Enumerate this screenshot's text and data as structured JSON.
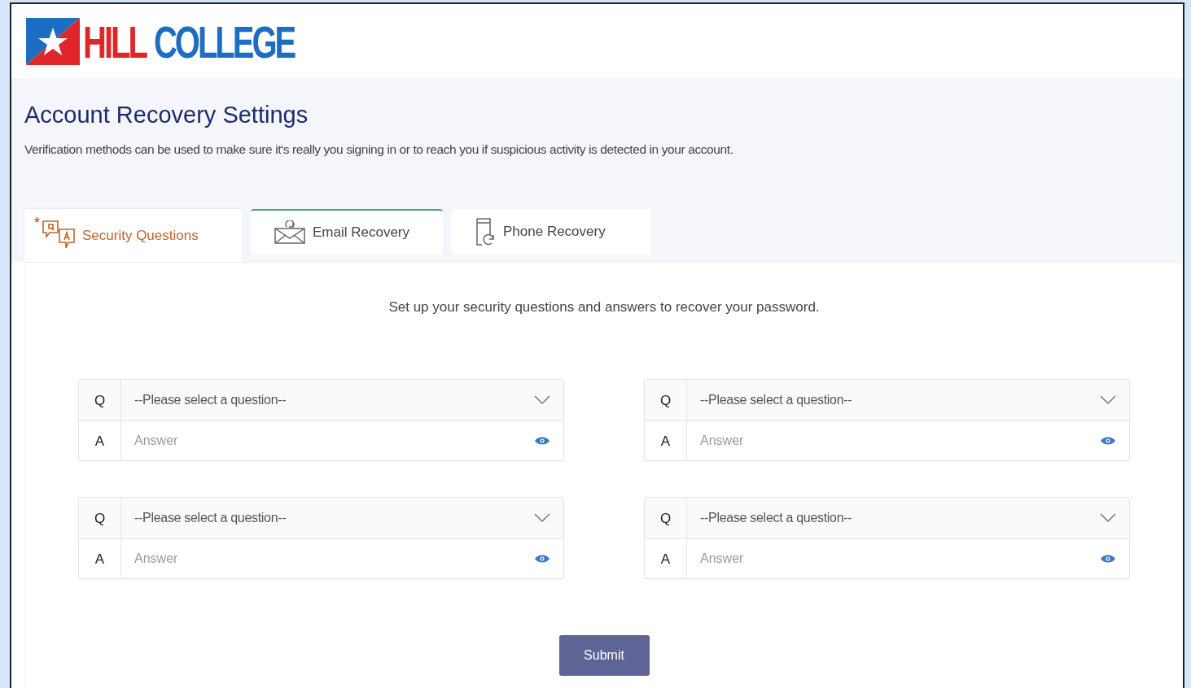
{
  "logo": {
    "word_1": "HILL",
    "word_2": "COLLEGE"
  },
  "page": {
    "title": "Account Recovery Settings",
    "description": "Verification methods can be used to make sure it's really you signing in or to reach you if suspicious activity is detected in your account."
  },
  "tabs": [
    {
      "label": "Security Questions",
      "kind": "questions",
      "selected": true,
      "required": true,
      "marker": "*",
      "configured": false
    },
    {
      "label": "Email Recovery",
      "kind": "email",
      "selected": false,
      "required": false,
      "configured": true
    },
    {
      "label": "Phone Recovery",
      "kind": "phone",
      "selected": false,
      "required": false,
      "configured": false
    }
  ],
  "intro": "Set up your security questions and answers to recover your password.",
  "question_sets": [
    {
      "q_label": "Q",
      "question": "--Please select a question--",
      "a_label": "A",
      "answer_placeholder": "Answer"
    },
    {
      "q_label": "Q",
      "question": "--Please select a question--",
      "a_label": "A",
      "answer_placeholder": "Answer"
    },
    {
      "q_label": "Q",
      "question": "--Please select a question--",
      "a_label": "A",
      "answer_placeholder": "Answer"
    },
    {
      "q_label": "Q",
      "question": "--Please select a question--",
      "a_label": "A",
      "answer_placeholder": "Answer"
    }
  ],
  "submit": "Submit"
}
